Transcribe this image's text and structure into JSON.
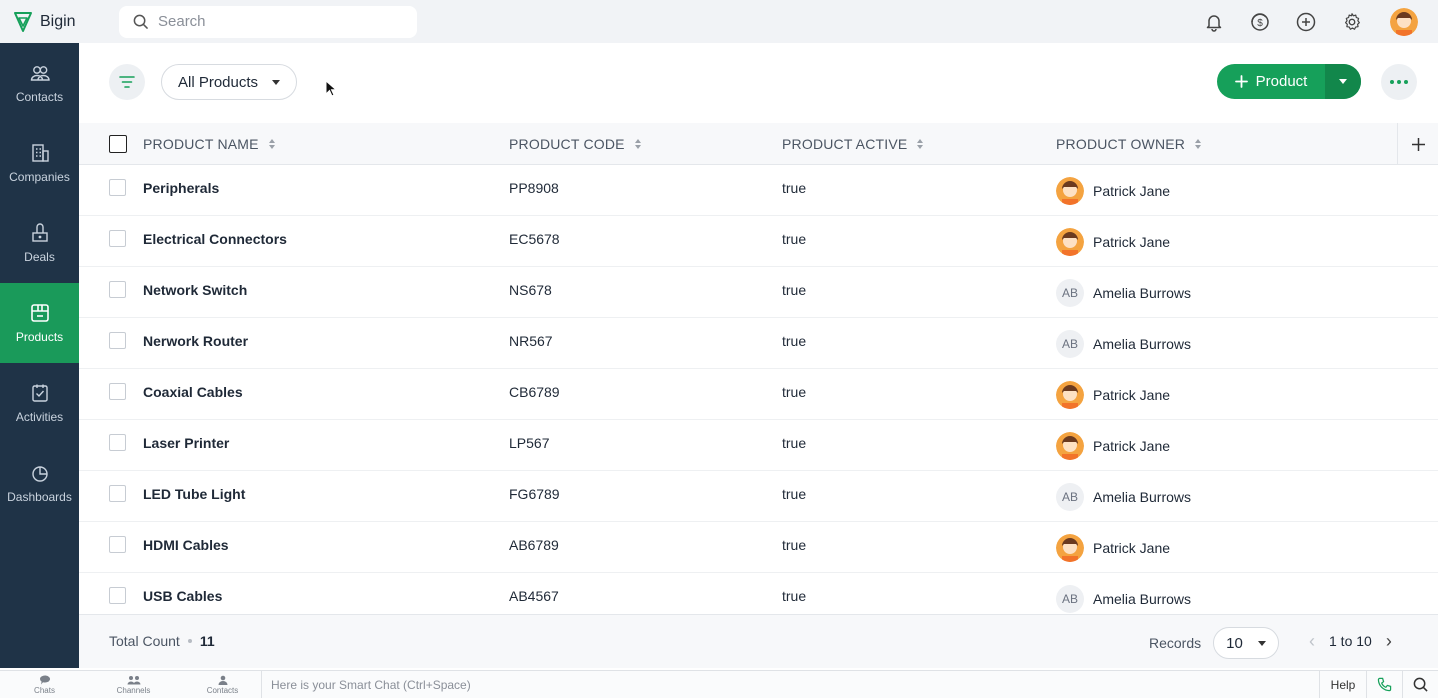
{
  "app": {
    "name": "Bigin"
  },
  "search": {
    "placeholder": "Search"
  },
  "sidebar": {
    "items": [
      {
        "label": "Contacts",
        "icon": "contacts-icon"
      },
      {
        "label": "Companies",
        "icon": "companies-icon"
      },
      {
        "label": "Deals",
        "icon": "deals-icon"
      },
      {
        "label": "Products",
        "icon": "products-icon",
        "active": true
      },
      {
        "label": "Activities",
        "icon": "activities-icon"
      },
      {
        "label": "Dashboards",
        "icon": "dashboards-icon"
      }
    ]
  },
  "toolbar": {
    "view_label": "All Products",
    "add_label": "Product"
  },
  "table": {
    "columns": [
      "PRODUCT NAME",
      "PRODUCT CODE",
      "PRODUCT ACTIVE",
      "PRODUCT OWNER"
    ],
    "rows": [
      {
        "name": "Peripherals",
        "code": "PP8908",
        "active": "true",
        "owner": "Patrick Jane",
        "avatar": "photo"
      },
      {
        "name": "Electrical Connectors",
        "code": "EC5678",
        "active": "true",
        "owner": "Patrick Jane",
        "avatar": "photo"
      },
      {
        "name": "Network Switch",
        "code": "NS678",
        "active": "true",
        "owner": "Amelia Burrows",
        "avatar": "AB"
      },
      {
        "name": "Nerwork Router",
        "code": "NR567",
        "active": "true",
        "owner": "Amelia Burrows",
        "avatar": "AB"
      },
      {
        "name": "Coaxial Cables",
        "code": "CB6789",
        "active": "true",
        "owner": "Patrick Jane",
        "avatar": "photo"
      },
      {
        "name": "Laser Printer",
        "code": "LP567",
        "active": "true",
        "owner": "Patrick Jane",
        "avatar": "photo"
      },
      {
        "name": "LED Tube Light",
        "code": "FG6789",
        "active": "true",
        "owner": "Amelia Burrows",
        "avatar": "AB"
      },
      {
        "name": "HDMI Cables",
        "code": "AB6789",
        "active": "true",
        "owner": "Patrick Jane",
        "avatar": "photo"
      },
      {
        "name": "USB Cables",
        "code": "AB4567",
        "active": "true",
        "owner": "Amelia Burrows",
        "avatar": "AB"
      }
    ]
  },
  "footer": {
    "total_label": "Total Count",
    "total_value": "11",
    "records_label": "Records",
    "per_page": "10",
    "range": "1 to 10"
  },
  "chatbar": {
    "items": [
      "Chats",
      "Channels",
      "Contacts"
    ],
    "placeholder": "Here is your Smart Chat (Ctrl+Space)",
    "help_label": "Help"
  },
  "colors": {
    "accent": "#16a05a",
    "sidebar": "#1f3347",
    "active_nav": "#1a9a5a"
  }
}
